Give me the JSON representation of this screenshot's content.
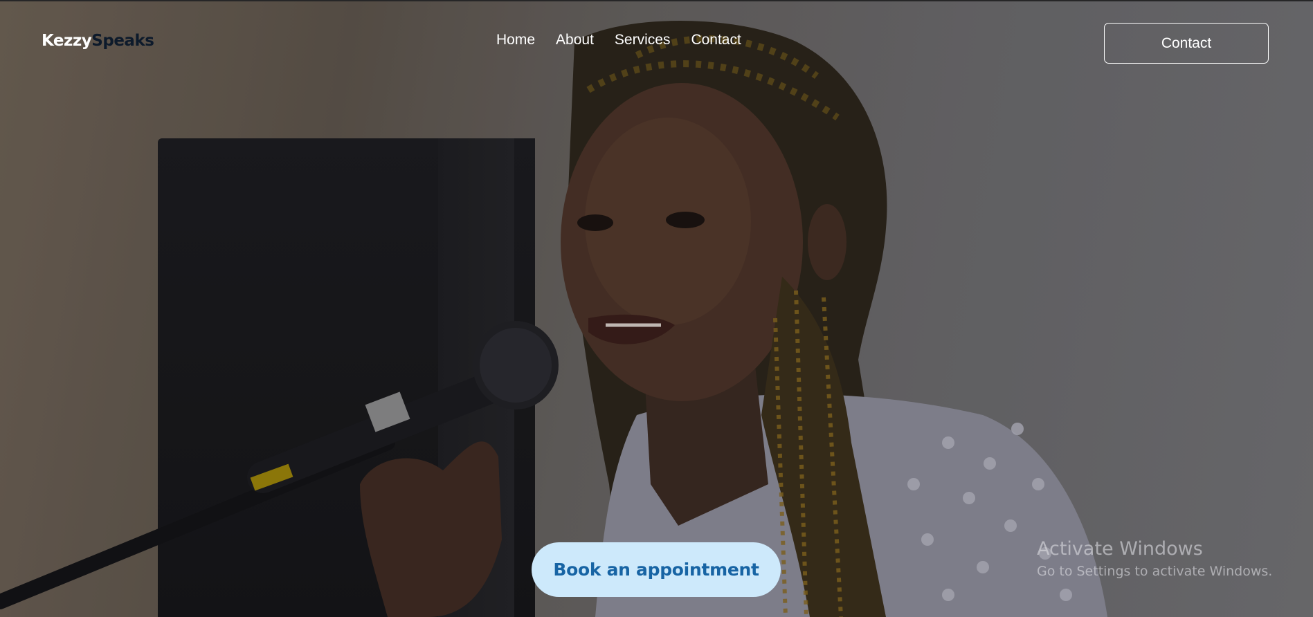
{
  "brand": {
    "part1": "Kezzy",
    "part2": "Speaks",
    "colors": {
      "part1": "#ffffff",
      "part2": "#0d1a2b"
    }
  },
  "nav": {
    "items": [
      {
        "label": "Home"
      },
      {
        "label": "About"
      },
      {
        "label": "Services"
      },
      {
        "label": "Contact"
      }
    ]
  },
  "header": {
    "contact_button": "Contact"
  },
  "hero": {
    "book_button": "Book an appointment",
    "book_button_colors": {
      "bg": "#cde9fb",
      "text": "#1764a4"
    }
  },
  "watermark": {
    "title": "Activate Windows",
    "subtitle": "Go to Settings to activate Windows."
  }
}
